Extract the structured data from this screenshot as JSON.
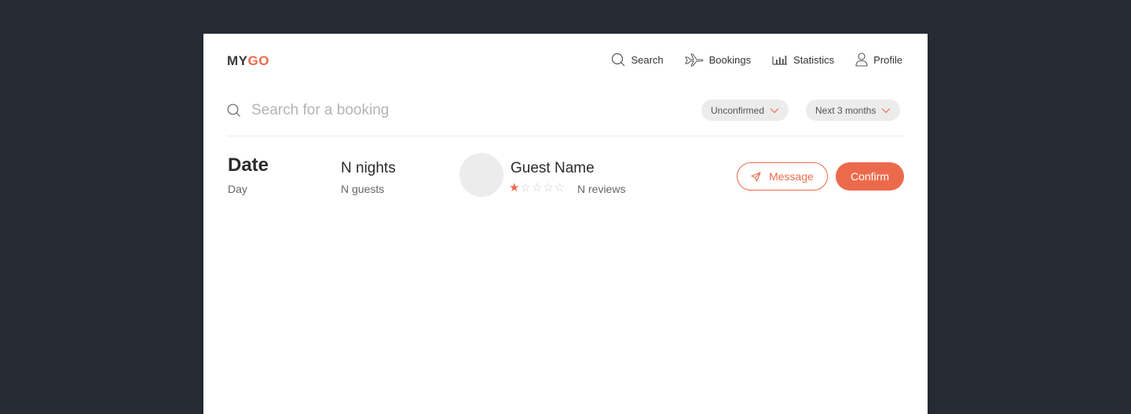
{
  "logo": {
    "part1": "MY",
    "part2": "GO"
  },
  "nav": {
    "search": "Search",
    "bookings": "Bookings",
    "statistics": "Statistics",
    "profile": "Profile"
  },
  "search": {
    "placeholder": "Search for a booking",
    "value": ""
  },
  "filters": {
    "status": "Unconfirmed",
    "period": "Next 3 months"
  },
  "booking": {
    "date": "Date",
    "day": "Day",
    "nights": "N nights",
    "guests": "N guests",
    "guest_name": "Guest Name",
    "rating": 1,
    "rating_max": 5,
    "reviews": "N reviews",
    "message_label": "Message",
    "confirm_label": "Confirm"
  },
  "colors": {
    "accent": "#ec6a4c",
    "background": "#252a33",
    "card": "#ffffff"
  }
}
